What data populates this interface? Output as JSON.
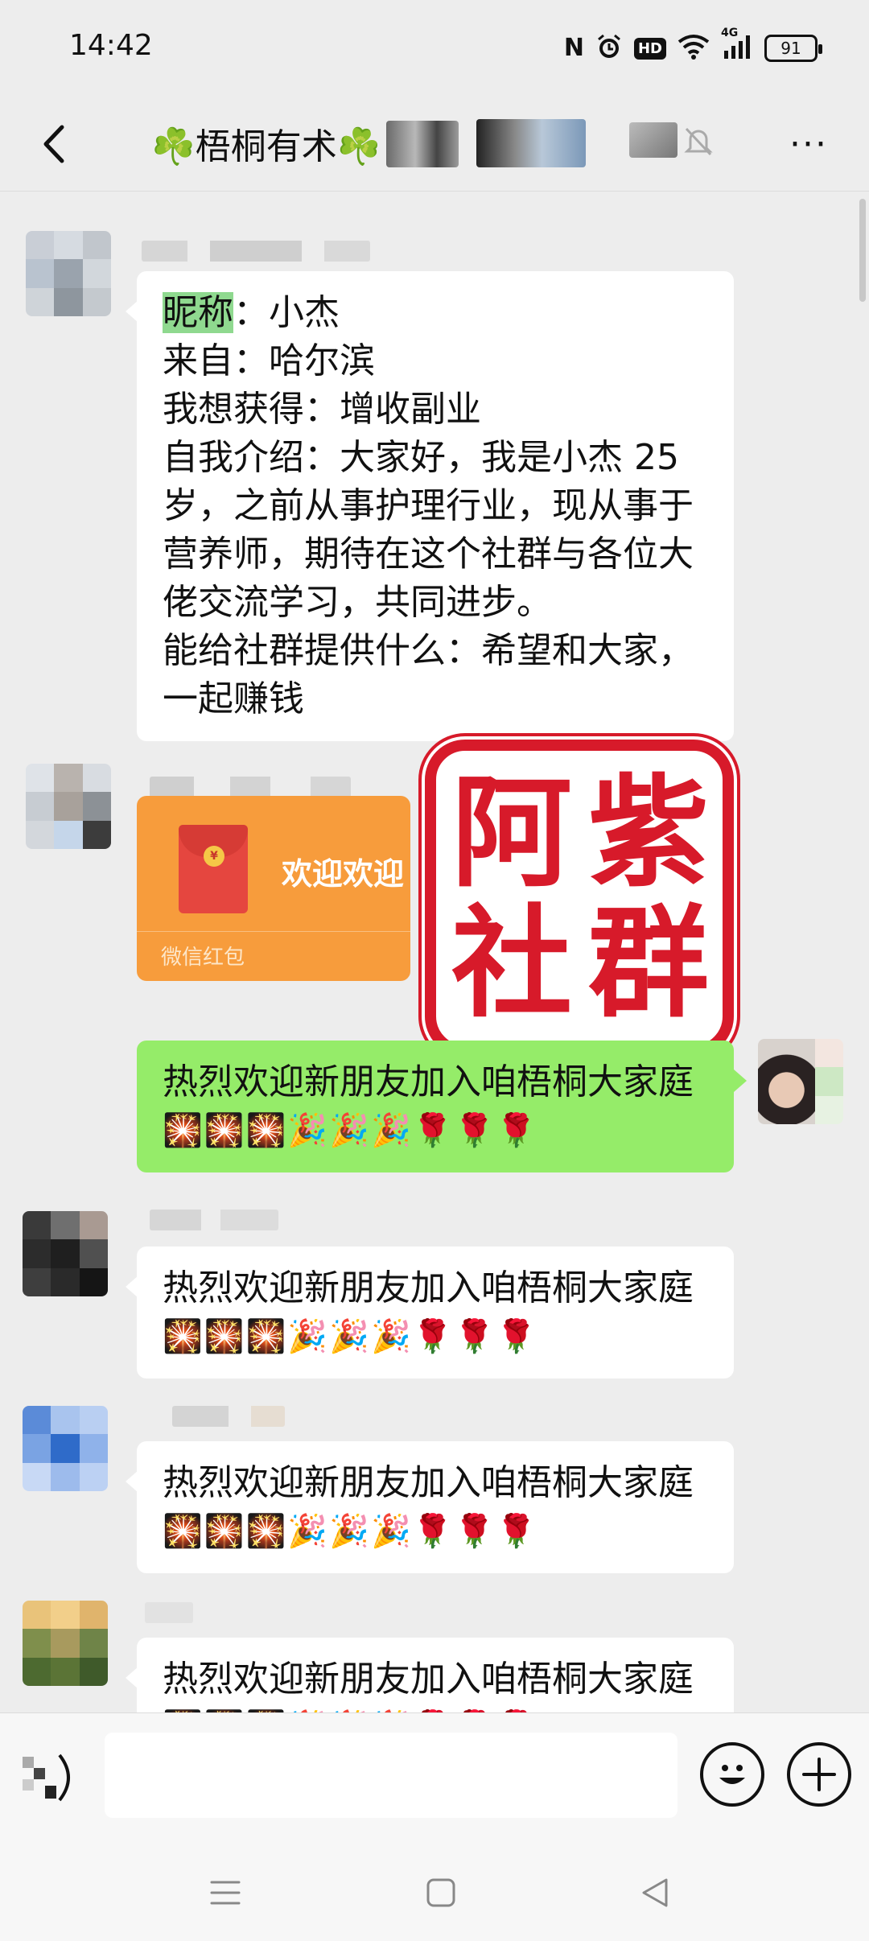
{
  "status_bar": {
    "time": "14:42",
    "hd_label": "HD",
    "network_label": "4G",
    "battery": "91"
  },
  "header": {
    "title": "☘️梧桐有术☘️",
    "more_glyph": "···"
  },
  "messages": [
    {
      "type": "text",
      "side": "left",
      "lines": [
        {
          "highlight": "昵称",
          "text": "：小杰"
        },
        {
          "text": "来自：哈尔滨"
        },
        {
          "text": "我想获得：增收副业"
        },
        {
          "text": "自我介绍：大家好，我是小杰 25"
        },
        {
          "text": "岁，之前从事护理行业，现从事于"
        },
        {
          "text": "营养师，期待在这个社群与各位大"
        },
        {
          "text": "佬交流学习，共同进步。"
        },
        {
          "text": "能给社群提供什么：希望和大家，"
        },
        {
          "text": "一起赚钱"
        }
      ]
    },
    {
      "type": "red_packet",
      "side": "left",
      "title": "欢迎欢迎",
      "label": "微信红包",
      "coin": "¥"
    },
    {
      "type": "text",
      "side": "right",
      "text": "热烈欢迎新朋友加入咱梧桐大家庭",
      "emoji": "🎇🎇🎇🎉🎉🎉🌹🌹🌹"
    },
    {
      "type": "text",
      "side": "left",
      "text": "热烈欢迎新朋友加入咱梧桐大家庭",
      "emoji": "🎇🎇🎇🎉🎉🎉🌹🌹🌹"
    },
    {
      "type": "text",
      "side": "left",
      "text": "热烈欢迎新朋友加入咱梧桐大家庭",
      "emoji": "🎇🎇🎇🎉🎉🎉🌹🌹🌹"
    },
    {
      "type": "text",
      "side": "left",
      "text": "热烈欢迎新朋友加入咱梧桐大家庭",
      "emoji": "🎇🎇🎇🎉🎉🎉🌹🌹🌹"
    }
  ],
  "watermark_stamp": [
    "阿",
    "紫",
    "社",
    "群"
  ],
  "input_bar": {
    "placeholder": ""
  },
  "colors": {
    "background": "#ededed",
    "my_bubble": "#95ec69",
    "other_bubble": "#ffffff",
    "red_packet": "#f79c3c",
    "stamp_red": "#d71a2a",
    "nickname_highlight": "#8fd98f"
  },
  "icons": [
    "back-chevron-icon",
    "mute-bell-icon",
    "more-icon",
    "voice-icon",
    "emoji-icon",
    "plus-icon",
    "menu-icon",
    "home-icon",
    "back-triangle-icon"
  ]
}
